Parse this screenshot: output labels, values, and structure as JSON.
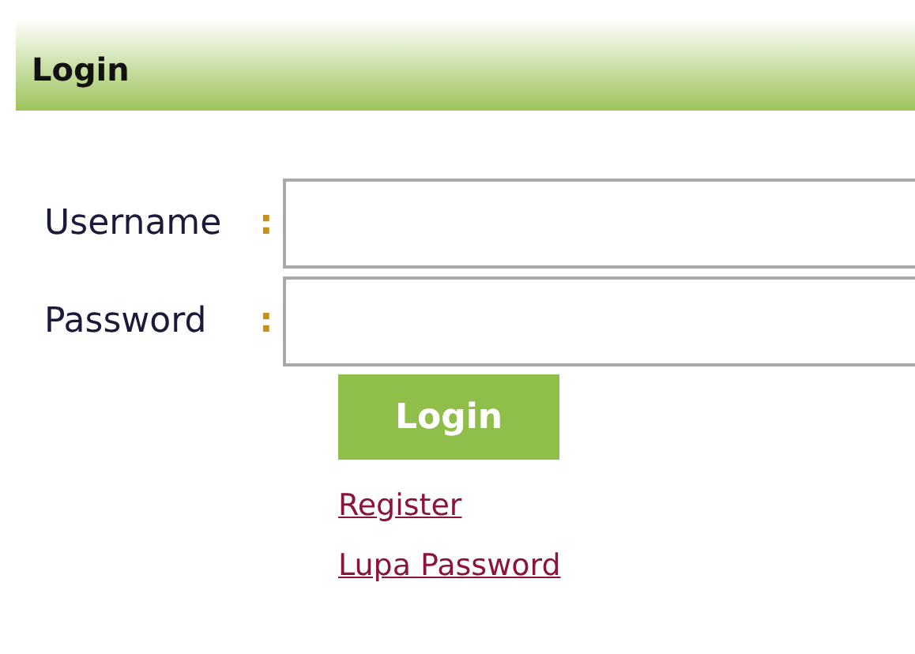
{
  "panel": {
    "title": "Login"
  },
  "fields": [
    {
      "label": "Username",
      "separator": ":"
    },
    {
      "label": "Password",
      "separator": ":"
    }
  ],
  "submit_button": "Login",
  "links": [
    "Register",
    "Lupa Password"
  ]
}
